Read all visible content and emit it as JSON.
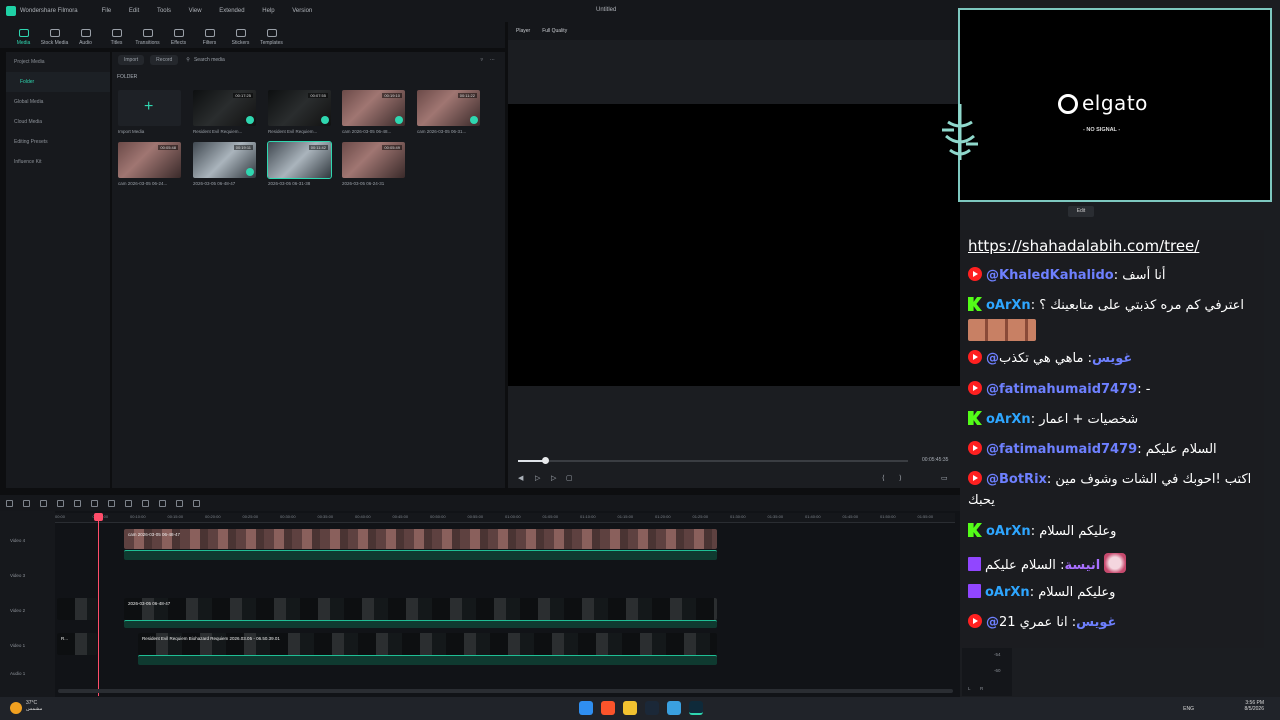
{
  "app": {
    "name": "Wondershare Filmora",
    "menu": [
      "File",
      "Edit",
      "Tools",
      "View",
      "Extended",
      "Help",
      "Version"
    ],
    "document_title": "Untitled"
  },
  "toolbar": {
    "tools": [
      "Media",
      "Stock Media",
      "Audio",
      "Titles",
      "Transitions",
      "Effects",
      "Filters",
      "Stickers",
      "Templates"
    ],
    "active": "Media"
  },
  "sidebar": {
    "items": [
      "Project Media",
      "Folder",
      "Global Media",
      "Cloud Media",
      "Editing Presets",
      "Influence Kit"
    ]
  },
  "media": {
    "import_label": "Import",
    "record_label": "Record",
    "search_placeholder": "Search media",
    "folder_label": "FOLDER",
    "import_media_label": "Import Media",
    "items": [
      {
        "label": "Resident Evil Requiem...",
        "duration": "00:17:25",
        "kind": "game"
      },
      {
        "label": "Resident Evil Requiem...",
        "duration": "00:07:55",
        "kind": "game"
      },
      {
        "label": "cam 2026-03-05 06-48...",
        "duration": "00:19:10",
        "kind": "cam"
      },
      {
        "label": "cam 2026-03-05 06-31...",
        "duration": "00:11:22",
        "kind": "cam"
      },
      {
        "label": "cam 2026-03-05 06-24...",
        "duration": "00:05:48",
        "kind": "cam"
      },
      {
        "label": "2026-03-05 06-48-47",
        "duration": "00:19:11",
        "kind": "snow"
      },
      {
        "label": "2026-03-05 06-31-38",
        "duration": "00:11:42",
        "kind": "snow"
      },
      {
        "label": "2026-03-05 06-24-31",
        "duration": "00:05:49",
        "kind": "cam"
      }
    ]
  },
  "player": {
    "label": "Player",
    "quality": "Full Quality",
    "time": "00:05:45:35"
  },
  "timeline": {
    "ruler": [
      "00:00",
      "00:05:00",
      "00:10:00",
      "00:15:00",
      "00:20:00",
      "00:25:00",
      "00:30:00",
      "00:35:00",
      "00:40:00",
      "00:45:00",
      "00:50:00",
      "00:55:00",
      "01:00:00",
      "01:05:00",
      "01:10:00",
      "01:15:00",
      "01:20:00",
      "01:25:00",
      "01:30:00",
      "01:35:00",
      "01:40:00",
      "01:45:00",
      "01:50:00",
      "01:55:00"
    ],
    "tracks": [
      "Video 4",
      "Video 3",
      "Video 2",
      "Video 1",
      "Audio 1"
    ],
    "clips": {
      "cam": "cam 2026-03-05 06-48-47",
      "game": "2026-03-05 06-48-47",
      "main": "Resident Evil Requiem Biohazard Requiem 2026.03.05 - 06.50.39.01",
      "small_v1": "R..."
    }
  },
  "overlay": {
    "elgato_logo": "elgato",
    "no_signal": "- NO SIGNAL -",
    "edit_label": "Edit"
  },
  "chat": {
    "link": "https://shahadalabih.com/tree/",
    "messages": [
      {
        "platform": "youtube",
        "user": "@KhaledKahalido",
        "text": "أنا أسف"
      },
      {
        "platform": "kick",
        "user": "oArXn",
        "text": "اعترفي كم مره كذبتي على متابعينك ؟"
      },
      {
        "platform": "youtube",
        "user": "@غويس",
        "text": "ماهي هي تكذب"
      },
      {
        "platform": "youtube",
        "user": "@fatimahumaid7479",
        "text": "-"
      },
      {
        "platform": "kick",
        "user": "oArXn",
        "text": "شخصيات + اعمار"
      },
      {
        "platform": "youtube",
        "user": "@fatimahumaid7479",
        "text": "السلام عليكم"
      },
      {
        "platform": "youtube",
        "user": "@BotRix",
        "text": "اكتب !احوبك في الشات وشوف مين"
      },
      {
        "platform": "none",
        "user": "",
        "text": "يحبك"
      },
      {
        "platform": "kick",
        "user": "oArXn",
        "text": "وعليكم السلام"
      },
      {
        "platform": "twitch",
        "user": "انيسة",
        "text": "السلام عليكم"
      },
      {
        "platform": "twitch",
        "user": "oArXn",
        "text": "وعليكم السلام"
      },
      {
        "platform": "youtube",
        "user": "@غويس",
        "text": "انا عمري 21"
      }
    ]
  },
  "meter": {
    "labels": [
      "-54",
      "-60",
      "L",
      "R"
    ]
  },
  "taskbar": {
    "temp": "37°C",
    "weather_text": "مشمس",
    "lang": "ENG",
    "time": "3:56 PM",
    "date": "8/5/2026"
  },
  "colors": {
    "accent": "#2fd7b0",
    "youtube": "#ff2020",
    "kick": "#53fc18",
    "twitch": "#9146ff",
    "playhead": "#ff4d6a"
  }
}
